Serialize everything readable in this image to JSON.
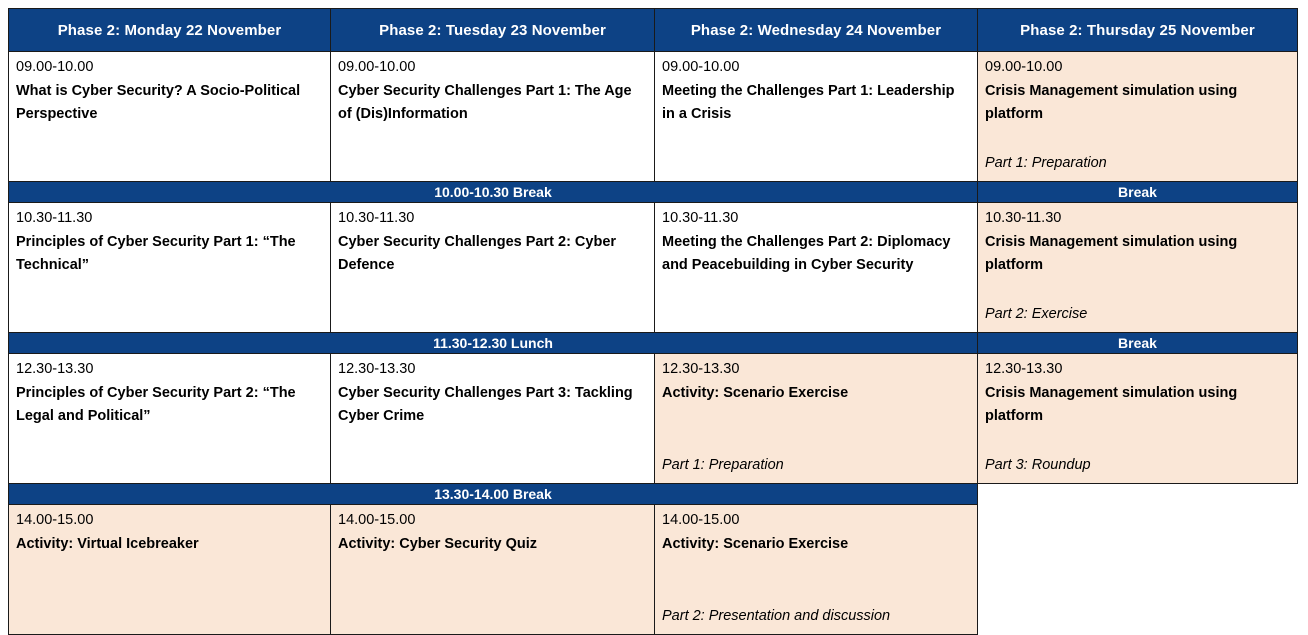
{
  "theme": {
    "header_blue": "#0d4285",
    "highlight_peach": "#fae7d7",
    "border": "#1a1a1a",
    "header_text": "#ffffff",
    "body_text": "#000000"
  },
  "table": {
    "columns": [
      {
        "id": "monday",
        "header": "Phase 2: Monday 22 November"
      },
      {
        "id": "tuesday",
        "header": "Phase 2: Tuesday 23 November"
      },
      {
        "id": "wednesday",
        "header": "Phase 2: Wednesday 24 November"
      },
      {
        "id": "thursday",
        "header": "Phase 2: Thursday 25 November"
      }
    ],
    "rows": [
      {
        "id": "row-0900",
        "cells": [
          {
            "time": "09.00-10.00",
            "title": "What is Cyber Security? A Socio-Political Perspective",
            "part": "",
            "highlight": false
          },
          {
            "time": "09.00-10.00",
            "title": "Cyber Security Challenges Part 1: The Age of (Dis)Information",
            "part": "",
            "highlight": false
          },
          {
            "time": "09.00-10.00",
            "title": "Meeting the Challenges Part 1: Leadership in a Crisis",
            "part": "",
            "highlight": false
          },
          {
            "time": "09.00-10.00",
            "title": "Crisis Management simulation using platform",
            "part": "Part 1: Preparation",
            "highlight": true
          }
        ]
      },
      {
        "id": "row-1030",
        "cells": [
          {
            "time": "10.30-11.30",
            "title": "Principles of Cyber Security Part 1: “The Technical”",
            "part": "",
            "highlight": false
          },
          {
            "time": "10.30-11.30",
            "title": "Cyber Security Challenges Part 2: Cyber Defence",
            "part": "",
            "highlight": false
          },
          {
            "time": "10.30-11.30",
            "title": "Meeting the Challenges Part 2: Diplomacy and Peacebuilding in Cyber Security",
            "part": "",
            "highlight": false
          },
          {
            "time": "10.30-11.30",
            "title": "Crisis Management simulation using platform",
            "part": "Part 2: Exercise",
            "highlight": true
          }
        ]
      },
      {
        "id": "row-1230",
        "cells": [
          {
            "time": "12.30-13.30",
            "title": "Principles of Cyber Security Part 2: “The Legal and Political”",
            "part": "",
            "highlight": false
          },
          {
            "time": "12.30-13.30",
            "title": "Cyber Security Challenges Part 3: Tackling Cyber Crime",
            "part": "",
            "highlight": false
          },
          {
            "time": "12.30-13.30",
            "title": "Activity: Scenario Exercise",
            "part": "Part 1: Preparation",
            "highlight": true
          },
          {
            "time": "12.30-13.30",
            "title": "Crisis Management simulation using platform",
            "part": "Part 3: Roundup",
            "highlight": true
          }
        ]
      },
      {
        "id": "row-1400",
        "cells": [
          {
            "time": "14.00-15.00",
            "title": "Activity: Virtual Icebreaker",
            "part": "",
            "highlight": true
          },
          {
            "time": "14.00-15.00",
            "title": "Activity: Cyber Security Quiz",
            "part": "",
            "highlight": true
          },
          {
            "time": "14.00-15.00",
            "title": "Activity: Scenario Exercise",
            "part": "Part 2: Presentation and discussion",
            "highlight": true
          },
          {
            "time": "",
            "title": "",
            "part": "",
            "empty": true
          }
        ]
      }
    ],
    "breaks": [
      {
        "id": "break-1000",
        "main_label": "10.00-10.30 Break",
        "thursday_label": "Break"
      },
      {
        "id": "break-1130",
        "main_label": "11.30-12.30 Lunch",
        "thursday_label": "Break"
      },
      {
        "id": "break-1330",
        "main_label": "13.30-14.00 Break",
        "thursday_label": ""
      }
    ]
  }
}
